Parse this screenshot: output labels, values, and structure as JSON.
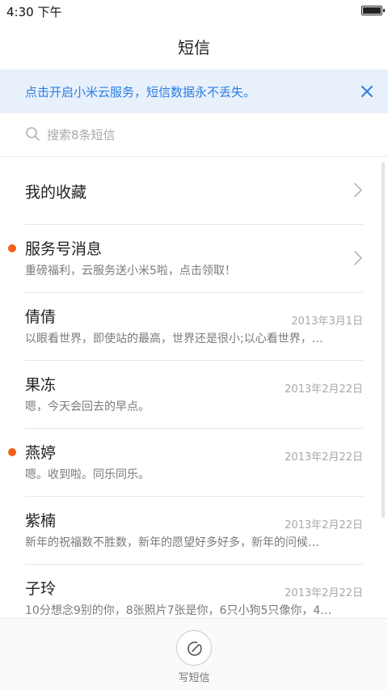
{
  "status_bar": {
    "time": "4:30 下午"
  },
  "header": {
    "title": "短信"
  },
  "banner": {
    "text": "点击开启小米云服务，短信数据永不丢失。",
    "accent": "#2b7de3",
    "background": "#e8f0fb"
  },
  "search": {
    "placeholder": "搜索8条短信",
    "value": ""
  },
  "list": {
    "unread_dot_color": "#f25f1a",
    "items": [
      {
        "name": "我的收藏",
        "date": "",
        "preview": "",
        "unread": false,
        "chevron": true
      },
      {
        "name": "服务号消息",
        "date": "",
        "preview": "重磅福利，云服务送小米5啦，点击领取！",
        "unread": true,
        "chevron": true
      },
      {
        "name": "倩倩",
        "date": "2013年3月1日",
        "preview": "以眼看世界，即使站的最高，世界还是很小;以心看世界，…",
        "unread": false,
        "chevron": false
      },
      {
        "name": "果冻",
        "date": "2013年2月22日",
        "preview": "嗯，今天会回去的早点。",
        "unread": false,
        "chevron": false
      },
      {
        "name": "燕婷",
        "date": "2013年2月22日",
        "preview": "嗯。收到啦。同乐同乐。",
        "unread": true,
        "chevron": false
      },
      {
        "name": "紫楠",
        "date": "2013年2月22日",
        "preview": "新年的祝福数不胜数，新年的愿望好多好多，新年的问候…",
        "unread": false,
        "chevron": false
      },
      {
        "name": "子玲",
        "date": "2013年2月22日",
        "preview": "10分想念9别的你，8张照片7张是你，6只小狗5只像你，4…",
        "unread": false,
        "chevron": false
      }
    ]
  },
  "bottom_bar": {
    "compose_label": "写短信"
  }
}
